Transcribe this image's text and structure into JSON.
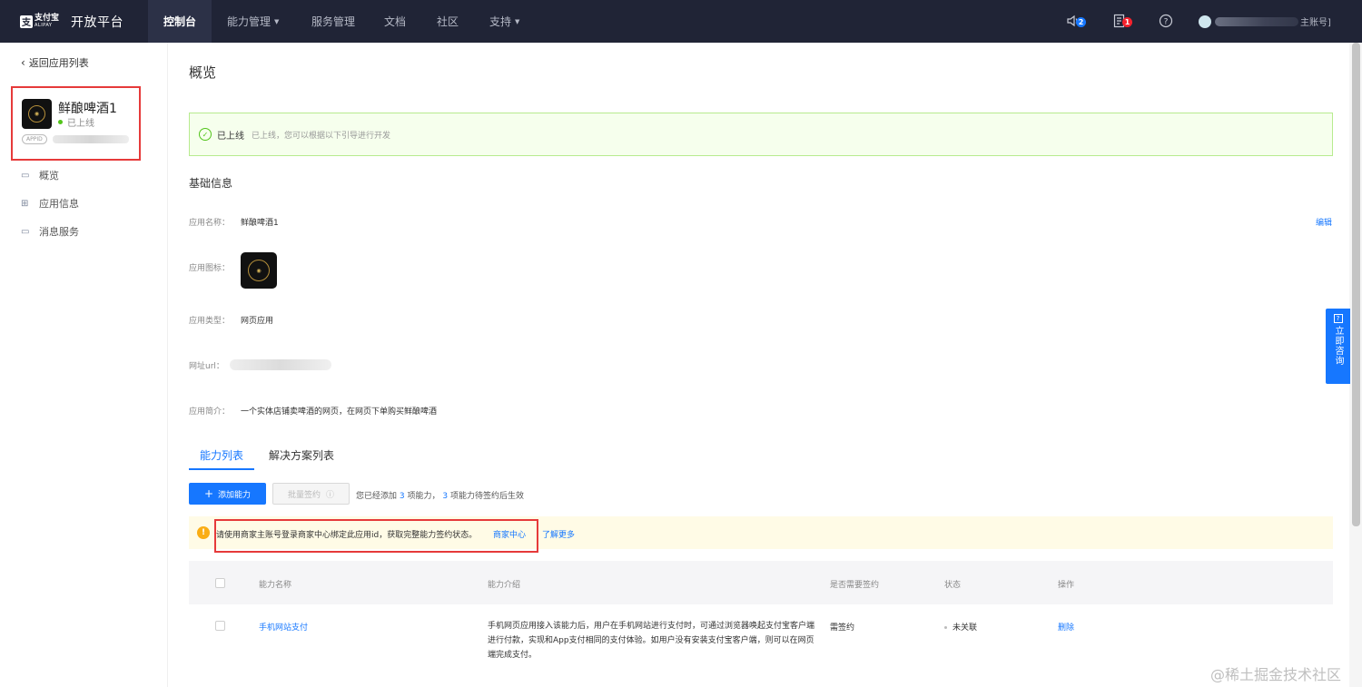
{
  "topnav": {
    "brand_logo_cn": "支付宝",
    "brand_logo_en": "ALIPAY",
    "brand_name": "开放平台",
    "items": [
      {
        "label": "控制台"
      },
      {
        "label": "能力管理"
      },
      {
        "label": "服务管理"
      },
      {
        "label": "文档"
      },
      {
        "label": "社区"
      },
      {
        "label": "支持"
      }
    ],
    "notice_count": "2",
    "todo_count": "1",
    "account_suffix": "主账号]"
  },
  "sidebar": {
    "back_label": "返回应用列表",
    "app_name": "鲜酿啤酒1",
    "app_status": "已上线",
    "appid_tag": "APPID",
    "menu": [
      {
        "label": "概览"
      },
      {
        "label": "应用信息"
      },
      {
        "label": "消息服务"
      }
    ]
  },
  "main": {
    "title": "概览",
    "alert": {
      "title": "已上线",
      "desc": "已上线，您可以根据以下引导进行开发"
    },
    "basic_info": {
      "title": "基础信息",
      "edit": "编辑",
      "fields": [
        {
          "label": "应用名称：",
          "value": "鲜酿啤酒1"
        },
        {
          "label": "应用图标：",
          "value": ""
        },
        {
          "label": "应用类型：",
          "value": "网页应用"
        },
        {
          "label": "网址url：",
          "value": ""
        },
        {
          "label": "应用简介：",
          "value": "一个实体店铺卖啤酒的网页，在网页下单购买鲜酿啤酒"
        }
      ]
    },
    "tabs": [
      {
        "label": "能力列表"
      },
      {
        "label": "解决方案列表"
      }
    ],
    "add_button": "添加能力",
    "batch_button": "批量签约",
    "added_pre": "您已经添加",
    "added_count": "3",
    "added_mid": "项能力，",
    "pending_count": "3",
    "added_post": "项能力待签约后生效",
    "warning": {
      "text": "请使用商家主账号登录商家中心绑定此应用id，获取完整能力签约状态。",
      "link1": "商家中心",
      "link2": "了解更多"
    },
    "table": {
      "headers": [
        "能力名称",
        "能力介绍",
        "是否需要签约",
        "状态",
        "操作"
      ],
      "rows": [
        {
          "name": "手机网站支付",
          "desc": "手机网页应用接入该能力后，用户在手机网站进行支付时，可通过浏览器唤起支付宝客户端进行付款，实现和App支付相同的支付体验。如用户没有安装支付宝客户端，则可以在网页端完成支付。",
          "sign": "需签约",
          "status": "未关联",
          "action": "删除"
        }
      ]
    }
  },
  "consult": {
    "label": "立即咨询"
  },
  "watermark": "@稀土掘金技术社区",
  "colors": {
    "nav_bg": "#202436",
    "primary": "#1677ff",
    "success": "#52c41a",
    "warning": "#faad14",
    "highlight_box": "#e63a3a"
  }
}
